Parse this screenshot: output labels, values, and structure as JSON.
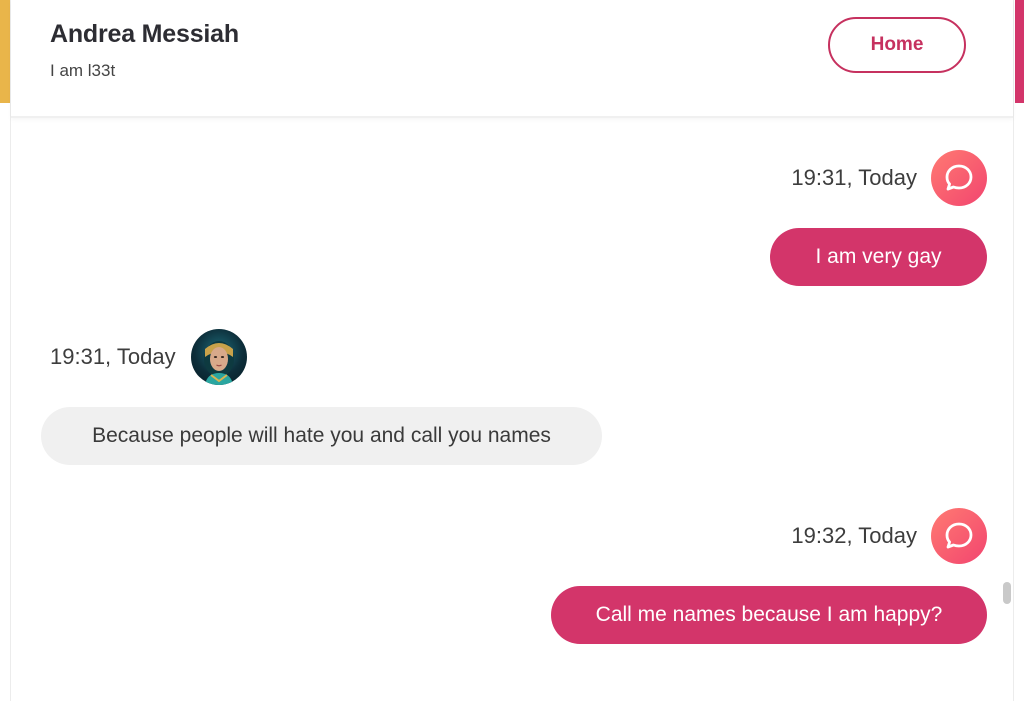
{
  "header": {
    "contact_name": "Andrea Messiah",
    "contact_status": "I am l33t",
    "home_label": "Home"
  },
  "messages": [
    {
      "direction": "outgoing",
      "time": "19:31, Today",
      "text": "I am very gay",
      "avatar": "chat-bubble-icon"
    },
    {
      "direction": "incoming",
      "time": "19:31, Today",
      "text": "Because people will hate you and call you names",
      "avatar": "user-avatar"
    },
    {
      "direction": "outgoing",
      "time": "19:32, Today",
      "text": "Call me names because I am happy?",
      "avatar": "chat-bubble-icon"
    }
  ],
  "colors": {
    "accent": "#d3356a",
    "accent_left_bar": "#e9b54a",
    "incoming_bubble": "#f0f0f0"
  }
}
